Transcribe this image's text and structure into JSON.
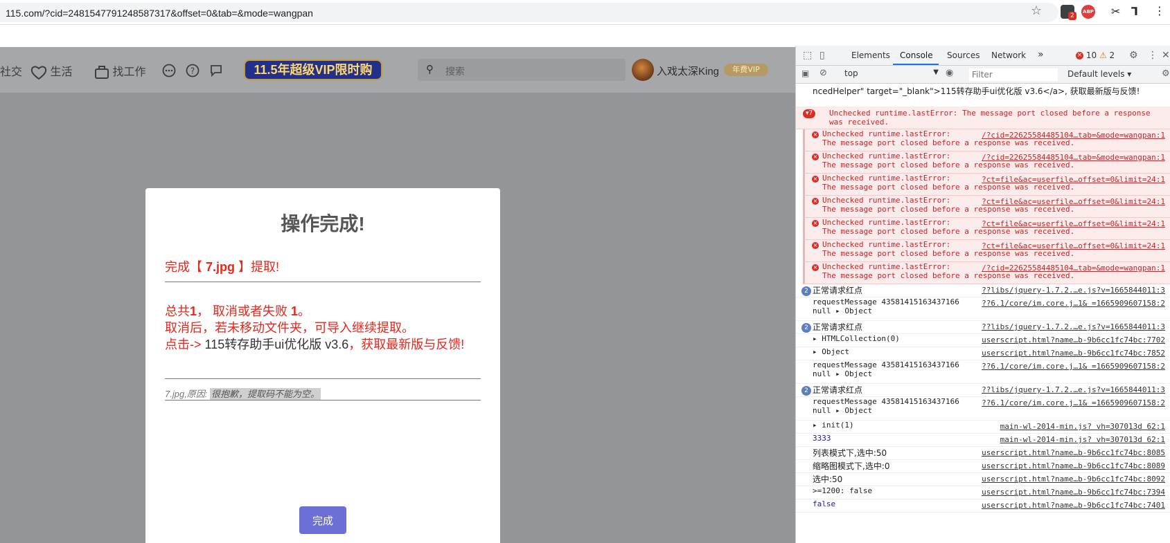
{
  "browser": {
    "url": "115.com/?cid=2481547791248587317&offset=0&tab=&mode=wangpan",
    "ext_badge": "2",
    "abp_label": "ABP"
  },
  "nav": {
    "item_partial": "社交",
    "item_life": "生活",
    "item_jobs": "找工作",
    "vip_banner": "11.5年超级VIP限时购",
    "search_placeholder": "搜索",
    "username": "入戏太深King",
    "vip_tag": "年费VIP"
  },
  "modal": {
    "title": "操作完成!",
    "complete_prefix": "完成【 ",
    "file_name": "7.jpg",
    "complete_suffix": " 】提取!",
    "total_prefix": "总共",
    "total_count": "1",
    "cancel_text": "， 取消或者失败 ",
    "fail_count": "1",
    "period": "。",
    "hint_line": "取消后，若未移动文件夹，可导入继续提取。",
    "click_prefix": "点击-> ",
    "link_text": "115转存助手ui优化版 v3.6",
    "click_suffix": "，获取最新版与反馈!",
    "reason_prefix": "7.jpg,原因: ",
    "reason_text": "很抱歉，提取码不能为空。",
    "done_button": "完成"
  },
  "devtools": {
    "tabs": [
      "Elements",
      "Console",
      "Sources",
      "Network"
    ],
    "more": "»",
    "error_count": "10",
    "warn_count": "2",
    "context": "top",
    "filter_placeholder": "Filter",
    "levels": "Default levels ▾",
    "console_rows": [
      {
        "type": "log",
        "text": "ncedHelper\" target=\"_blank\">115转存助手ui优化版 v3.6</a>, 获取最新版与反馈!",
        "src": ""
      },
      {
        "type": "group",
        "badge": "▾7",
        "text": "Unchecked runtime.lastError: The message port closed before a response",
        "text2": "was received.",
        "src": ""
      },
      {
        "type": "err",
        "text": "Unchecked runtime.lastError:",
        "text2": "The message port closed before a response was received.",
        "src": "/?cid=22625584485104…tab=&mode=wangpan:1"
      },
      {
        "type": "err",
        "text": "Unchecked runtime.lastError:",
        "text2": "The message port closed before a response was received.",
        "src": "/?cid=22625584485104…tab=&mode=wangpan:1"
      },
      {
        "type": "err",
        "text": "Unchecked runtime.lastError:",
        "text2": "The message port closed before a response was received.",
        "src": "?ct=file&ac=userfile…offset=0&limit=24:1"
      },
      {
        "type": "err",
        "text": "Unchecked runtime.lastError:",
        "text2": "The message port closed before a response was received.",
        "src": "?ct=file&ac=userfile…offset=0&limit=24:1"
      },
      {
        "type": "err",
        "text": "Unchecked runtime.lastError:",
        "text2": "The message port closed before a response was received.",
        "src": "?ct=file&ac=userfile…offset=0&limit=24:1"
      },
      {
        "type": "err",
        "text": "Unchecked runtime.lastError:",
        "text2": "The message port closed before a response was received.",
        "src": "?ct=file&ac=userfile…offset=0&limit=24:1"
      },
      {
        "type": "err",
        "text": "Unchecked runtime.lastError:",
        "text2": "The message port closed before a response was received.",
        "src": "/?cid=22625584485104…tab=&mode=wangpan:1"
      },
      {
        "type": "count",
        "badge": "2",
        "text": "正常请求红点",
        "src": "??libs/jquery-1.7.2.…e.js?v=1665844011:3"
      },
      {
        "type": "log2",
        "text": "requestMessage 43581415163437166",
        "text2": "null ▸ Object",
        "src": "??6.1/core/im.core.j…1& =1665909607158:2"
      },
      {
        "type": "count",
        "badge": "2",
        "text": "正常请求红点",
        "src": "??libs/jquery-1.7.2.…e.js?v=1665844011:3"
      },
      {
        "type": "log",
        "text": "▸ HTMLCollection(0)",
        "src": "userscript.html?name…b-9b6cc1fc74bc:7702"
      },
      {
        "type": "log",
        "text": "▸ Object",
        "src": "userscript.html?name…b-9b6cc1fc74bc:7852"
      },
      {
        "type": "log2",
        "text": "requestMessage 43581415163437166",
        "text2": "null ▸ Object",
        "src": "??6.1/core/im.core.j…1& =1665909607158:2"
      },
      {
        "type": "count",
        "badge": "2",
        "text": "正常请求红点",
        "src": "??libs/jquery-1.7.2.…e.js?v=1665844011:3"
      },
      {
        "type": "log2",
        "text": "requestMessage 43581415163437166",
        "text2": "null ▸ Object",
        "src": "??6.1/core/im.core.j…1& =1665909607158:2"
      },
      {
        "type": "log",
        "text": "▸ init(1)",
        "src": "main-wl-2014-min.js? vh=307013d 62:1"
      },
      {
        "type": "blue",
        "text": "3333",
        "src": "main-wl-2014-min.js? vh=307013d 62:1"
      },
      {
        "type": "log",
        "text": "列表模式下,选中:50",
        "src": "userscript.html?name…b-9b6cc1fc74bc:8085"
      },
      {
        "type": "log",
        "text": "缩略图模式下,选中:0",
        "src": "userscript.html?name…b-9b6cc1fc74bc:8089"
      },
      {
        "type": "log",
        "text": "选中:50",
        "src": "userscript.html?name…b-9b6cc1fc74bc:8092"
      },
      {
        "type": "log",
        "text": ">=1200: false",
        "src": "userscript.html?name…b-9b6cc1fc74bc:7394"
      },
      {
        "type": "blue",
        "text": "false",
        "src": "userscript.html?name…b-9b6cc1fc74bc:7401"
      }
    ]
  }
}
